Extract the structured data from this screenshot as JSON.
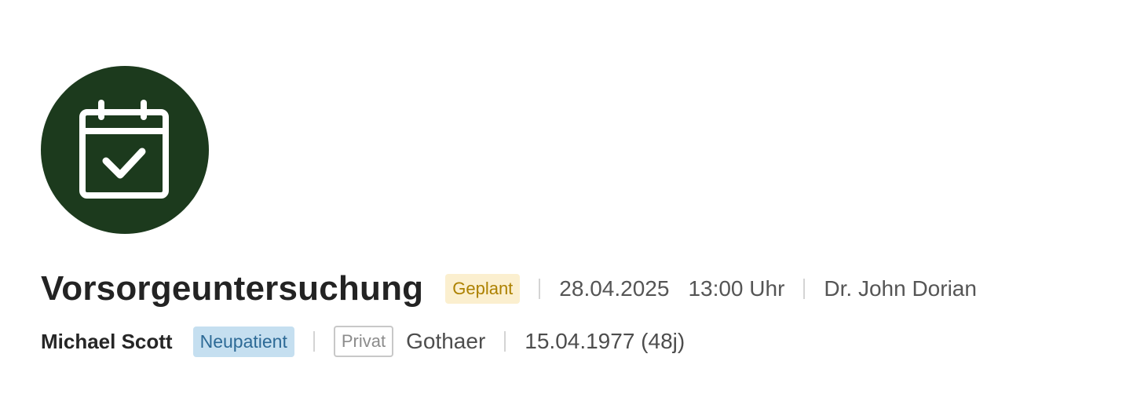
{
  "appointment": {
    "icon": "calendar-check-icon",
    "accent_color": "#1c3a1d",
    "title": "Vorsorgeuntersuchung",
    "status": "Geplant",
    "date": "28.04.2025",
    "time": "13:00 Uhr",
    "doctor": "Dr. John Dorian"
  },
  "patient": {
    "name": "Michael Scott",
    "tag": "Neupatient",
    "insurance_type": "Privat",
    "insurer": "Gothaer",
    "birthdate_age": "15.04.1977 (48j)"
  }
}
